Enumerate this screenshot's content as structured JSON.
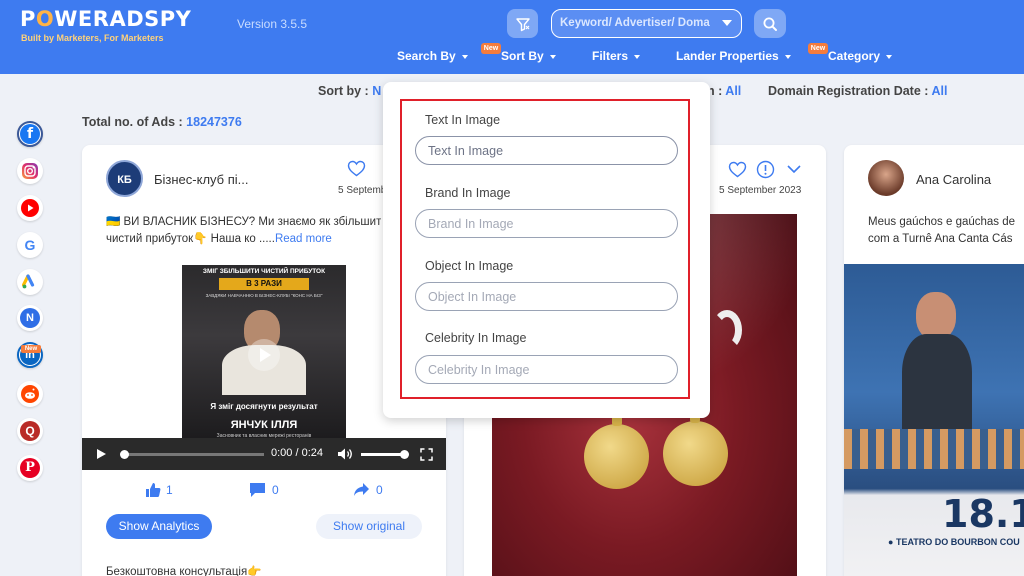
{
  "header": {
    "logo": {
      "part1": "P",
      "o": "O",
      "part2": "WERADSPY"
    },
    "tagline": "Built by Marketers, For Marketers",
    "version": "Version 3.5.5",
    "keyword_select": "Keyword/ Advertiser/ Doma",
    "nav": {
      "search_by": "Search By",
      "sort_by": "Sort By",
      "filters": "Filters",
      "lander_properties": "Lander Properties",
      "category": "Category"
    },
    "new_badge": "New"
  },
  "sort_row": {
    "sort_label": "Sort by :",
    "sort_value": "N",
    "mid_label": "n :",
    "mid_value": "All",
    "domain_label": "Domain Registration Date :",
    "domain_value": "All"
  },
  "total": {
    "label": "Total no. of Ads :",
    "value": "18247376"
  },
  "sidebar": {
    "icons": [
      "facebook-icon",
      "instagram-icon",
      "youtube-icon",
      "google-icon",
      "google-ads-icon",
      "native-icon",
      "linkedin-icon",
      "reddit-icon",
      "quora-icon",
      "pinterest-icon"
    ],
    "new_badge": "New"
  },
  "cards": [
    {
      "advertiser": "Бізнес-клуб пі...",
      "avatar_text": "КБ",
      "date": "5 Septemb",
      "text_line1": "🇺🇦 ВИ ВЛАСНИК БІЗНЕСУ? Ми знаємо як збільшити",
      "text_line2": "чистий прибуток👇 Наша ко .....",
      "read_more": "Read more",
      "video": {
        "headline1": "ЗМІГ ЗБІЛЬШИТИ ЧИСТИЙ ПРИБУТОК",
        "headline2": "В 3 РАЗИ",
        "headline3": "ЗАВДЯКИ НАВЧАННЮ В БІЗНЕС-КЛУБІ \"КОНС НА БІЗ\"",
        "caption": "Я зміг досягнути результат",
        "name": "ЯНЧУК ІЛЛЯ",
        "subcaption": "Засновник та власник мережі ресторанів",
        "time": "0:00 / 0:24",
        "progress": 0.0
      },
      "likes": "1",
      "comments": "0",
      "shares": "0",
      "show_analytics": "Show Analytics",
      "show_original": "Show original",
      "footer_text": "Безкоштовна консультація👉"
    },
    {
      "date": "5 September 2023"
    },
    {
      "advertiser": "Ana Carolina",
      "text_line1": "Meus gaúchos e gaúchas de",
      "text_line2": "com a Turnê Ana Canta Cás",
      "poster_date": "18.1",
      "venue": "TEATRO DO BOURBON COU"
    }
  ],
  "dropdown": {
    "fields": [
      {
        "label": "Text In Image",
        "placeholder": "Text In Image"
      },
      {
        "label": "Brand In Image",
        "placeholder": "Brand In Image"
      },
      {
        "label": "Object In Image",
        "placeholder": "Object In Image"
      },
      {
        "label": "Celebrity In Image",
        "placeholder": "Celebrity In Image"
      }
    ],
    "highlight_color": "#e0202a"
  },
  "colors": {
    "accent": "#3e7bf0",
    "badge": "#f57c3c",
    "background": "#eef1f7"
  }
}
